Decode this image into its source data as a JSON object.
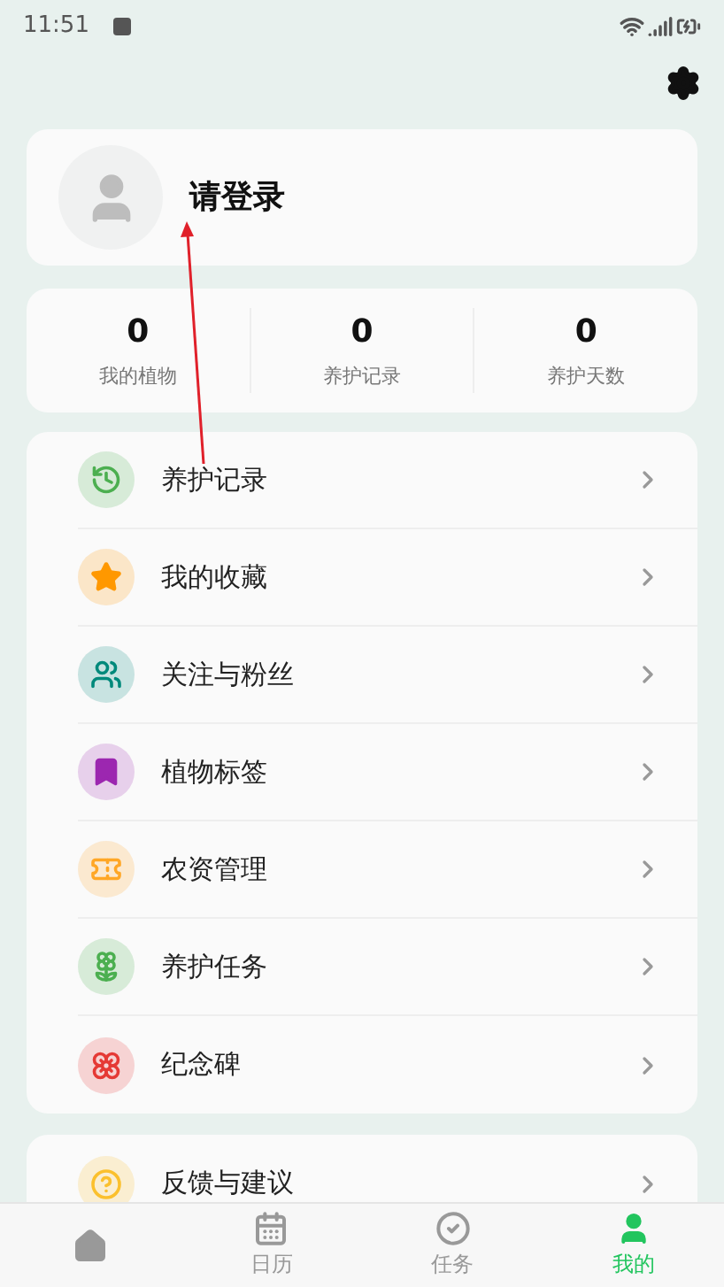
{
  "status_bar": {
    "time": "11:51"
  },
  "profile": {
    "login_prompt": "请登录"
  },
  "stats": [
    {
      "value": "0",
      "label": "我的植物"
    },
    {
      "value": "0",
      "label": "养护记录"
    },
    {
      "value": "0",
      "label": "养护天数"
    }
  ],
  "menu": [
    {
      "label": "养护记录",
      "color": "#4caf50"
    },
    {
      "label": "我的收藏",
      "color": "#ff9800"
    },
    {
      "label": "关注与粉丝",
      "color": "#00897b"
    },
    {
      "label": "植物标签",
      "color": "#9c27b0"
    },
    {
      "label": "农资管理",
      "color": "#ffa726"
    },
    {
      "label": "养护任务",
      "color": "#4caf50"
    },
    {
      "label": "纪念碑",
      "color": "#e53935"
    }
  ],
  "menu_2": [
    {
      "label": "反馈与建议",
      "color": "#fbc02d"
    }
  ],
  "bottom_nav": [
    {
      "selected": false
    },
    {
      "label": "日历",
      "selected": false
    },
    {
      "label": "任务",
      "selected": false
    },
    {
      "label": "我的",
      "selected": true
    }
  ]
}
